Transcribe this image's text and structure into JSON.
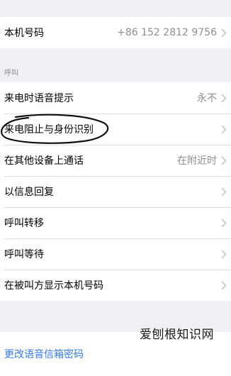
{
  "my_number": {
    "label": "本机号码",
    "value": "+86 152 2812 9756"
  },
  "calls_section": {
    "header": "呼叫",
    "rows": [
      {
        "label": "来电时语音提示",
        "value": "永不"
      },
      {
        "label": "来电阻止与身份识别",
        "value": ""
      },
      {
        "label": "在其他设备上通话",
        "value": "在附近时"
      },
      {
        "label": "以信息回复",
        "value": ""
      },
      {
        "label": "呼叫转移",
        "value": ""
      },
      {
        "label": "呼叫等待",
        "value": ""
      },
      {
        "label": "在被叫方显示本机号码",
        "value": ""
      }
    ]
  },
  "voicemail": {
    "change_password_label": "更改语音信箱密码"
  },
  "watermark": "爱刨根知识网",
  "colors": {
    "background": "#efeff4",
    "link": "#2f7cf6",
    "secondary_text": "#8e8e93"
  }
}
